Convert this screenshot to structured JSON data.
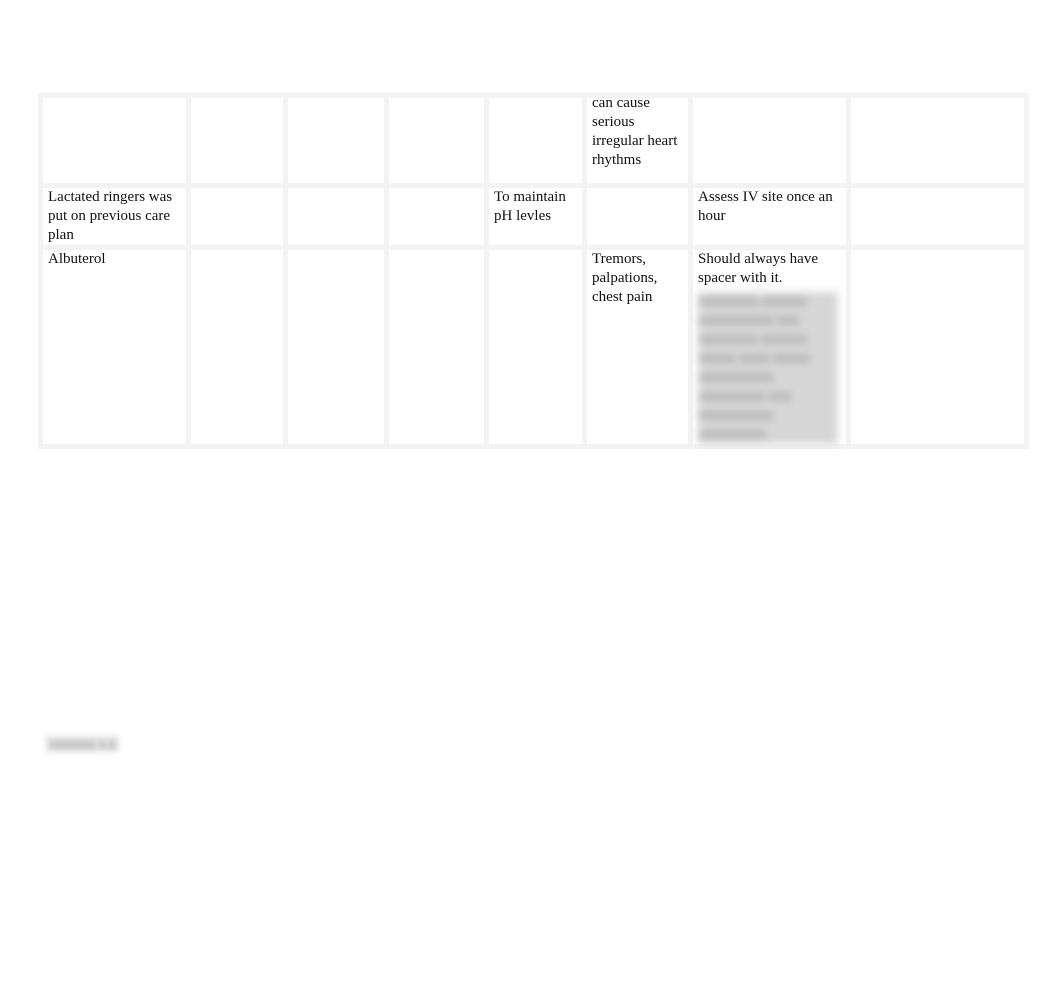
{
  "document": {
    "table": {
      "columns": 8,
      "rows": [
        {
          "cells": [
            "",
            "",
            "",
            "",
            "",
            "can cause serious irregular heart rhythms",
            "",
            ""
          ]
        },
        {
          "cells": [
            "Lactated ringers was put on previous care plan",
            "",
            "",
            "",
            "To maintain pH levles",
            "",
            "Assess IV site once an hour",
            ""
          ]
        },
        {
          "cells": [
            "Albuterol",
            "",
            "",
            "",
            "",
            "Tremors, palpations, chest pain",
            "Should always have spacer with it.",
            ""
          ],
          "blurred_note": "(obscured text)"
        }
      ]
    },
    "footer_label": "(obscured)"
  }
}
